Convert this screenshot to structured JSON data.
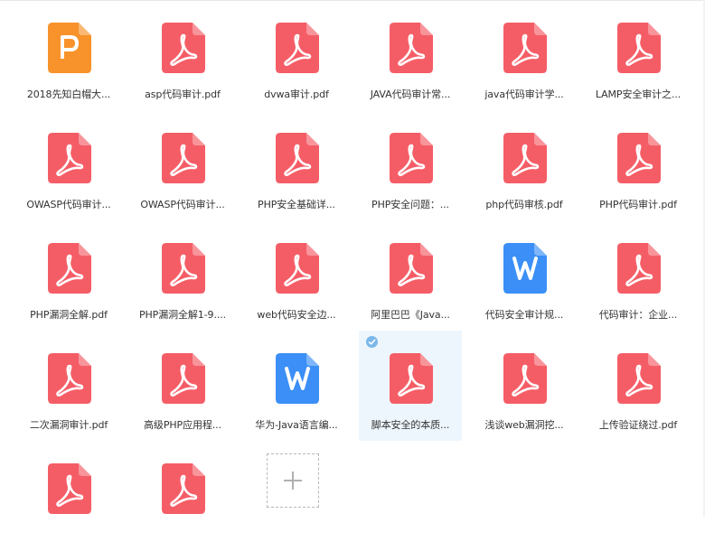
{
  "colors": {
    "pdf": "#f55d66",
    "ppt": "#f8922a",
    "word": "#3b8ff6",
    "selected_bg": "#eef6fd"
  },
  "files": [
    {
      "name": "2018先知白帽大...",
      "type": "ppt",
      "icon": "ppt-icon"
    },
    {
      "name": "asp代码审计.pdf",
      "type": "pdf",
      "icon": "pdf-icon"
    },
    {
      "name": "dvwa审计.pdf",
      "type": "pdf",
      "icon": "pdf-icon"
    },
    {
      "name": "JAVA代码审计常...",
      "type": "pdf",
      "icon": "pdf-icon"
    },
    {
      "name": "java代码审计学...",
      "type": "pdf",
      "icon": "pdf-icon"
    },
    {
      "name": "LAMP安全审计之...",
      "type": "pdf",
      "icon": "pdf-icon"
    },
    {
      "name": "OWASP代码审计...",
      "type": "pdf",
      "icon": "pdf-icon"
    },
    {
      "name": "OWASP代码审计...",
      "type": "pdf",
      "icon": "pdf-icon"
    },
    {
      "name": "PHP安全基础详...",
      "type": "pdf",
      "icon": "pdf-icon"
    },
    {
      "name": "PHP安全问题：...",
      "type": "pdf",
      "icon": "pdf-icon"
    },
    {
      "name": "php代码审核.pdf",
      "type": "pdf",
      "icon": "pdf-icon"
    },
    {
      "name": "PHP代码审计.pdf",
      "type": "pdf",
      "icon": "pdf-icon"
    },
    {
      "name": "PHP漏洞全解.pdf",
      "type": "pdf",
      "icon": "pdf-icon"
    },
    {
      "name": "PHP漏洞全解1-9....",
      "type": "pdf",
      "icon": "pdf-icon"
    },
    {
      "name": "web代码安全边...",
      "type": "pdf",
      "icon": "pdf-icon"
    },
    {
      "name": "阿里巴巴《Java...",
      "type": "pdf",
      "icon": "pdf-icon"
    },
    {
      "name": "代码安全审计规...",
      "type": "word",
      "icon": "word-icon"
    },
    {
      "name": "代码审计：企业...",
      "type": "pdf",
      "icon": "pdf-icon"
    },
    {
      "name": "二次漏洞审计.pdf",
      "type": "pdf",
      "icon": "pdf-icon"
    },
    {
      "name": "高级PHP应用程...",
      "type": "pdf",
      "icon": "pdf-icon"
    },
    {
      "name": "华为-Java语言编...",
      "type": "word",
      "icon": "word-icon"
    },
    {
      "name": "脚本安全的本质...",
      "type": "pdf",
      "icon": "pdf-icon",
      "selected": true
    },
    {
      "name": "浅谈web漏洞挖...",
      "type": "pdf",
      "icon": "pdf-icon"
    },
    {
      "name": "上传验证绕过.pdf",
      "type": "pdf",
      "icon": "pdf-icon"
    },
    {
      "name": "",
      "type": "pdf",
      "icon": "pdf-icon"
    },
    {
      "name": "",
      "type": "pdf",
      "icon": "pdf-icon"
    }
  ],
  "add_tile": {
    "icon": "plus-icon"
  }
}
